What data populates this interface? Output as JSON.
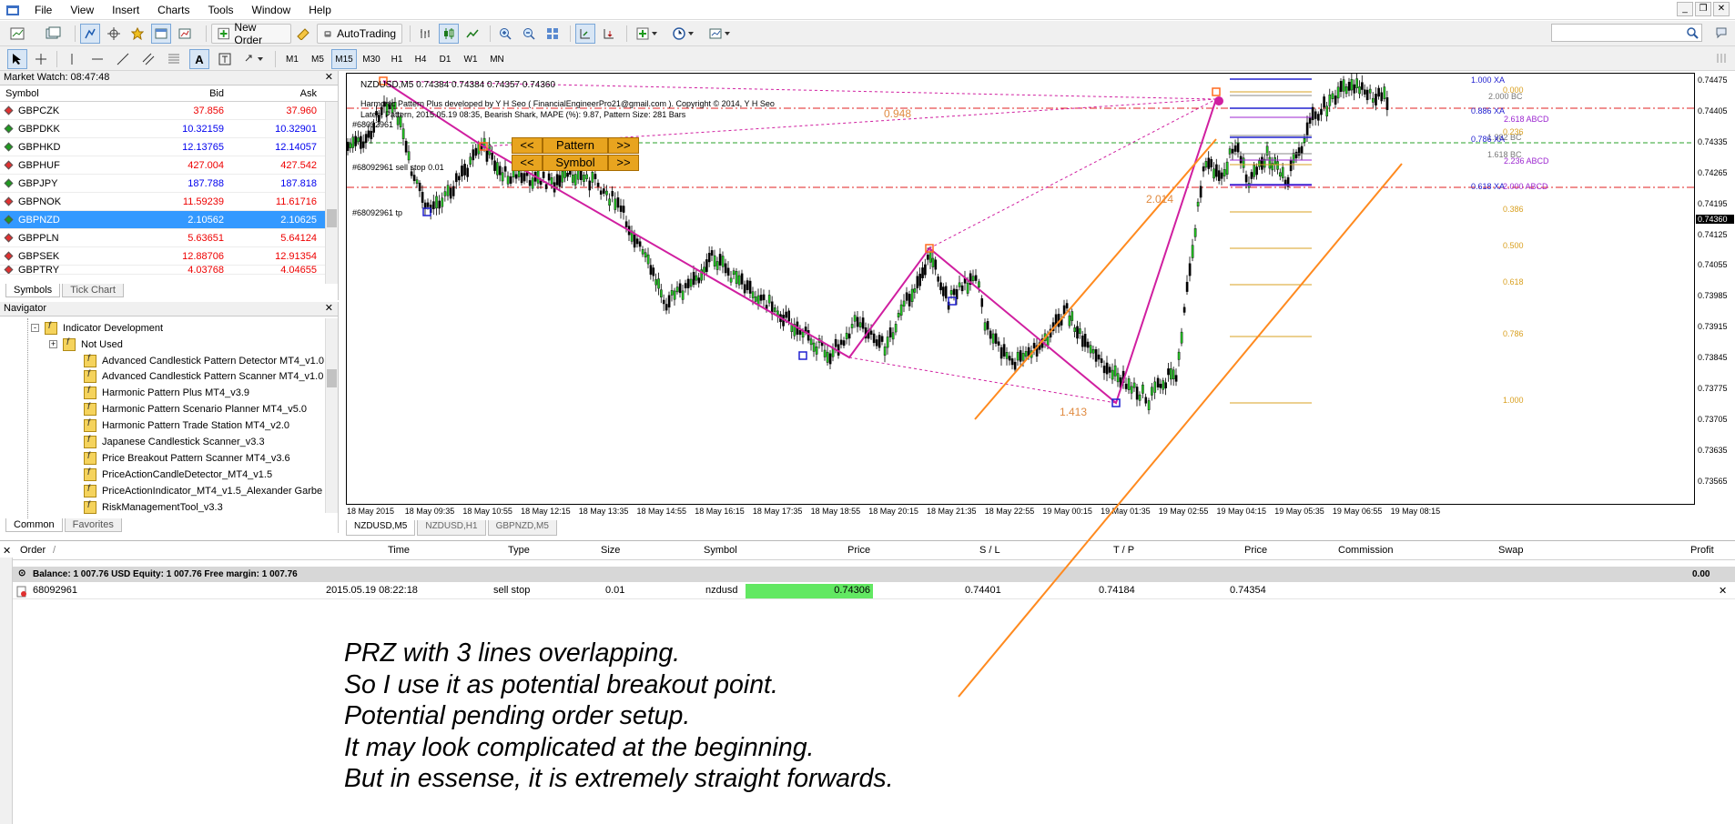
{
  "menu": [
    "File",
    "View",
    "Insert",
    "Charts",
    "Tools",
    "Window",
    "Help"
  ],
  "toolbar": {
    "new_order": "New Order",
    "autotrading": "AutoTrading",
    "timeframes": [
      "M1",
      "M5",
      "M15",
      "M30",
      "H1",
      "H4",
      "D1",
      "W1",
      "MN"
    ],
    "active_timeframe": "M15"
  },
  "market_watch": {
    "title": "Market Watch: 08:47:48",
    "columns": [
      "Symbol",
      "Bid",
      "Ask"
    ],
    "rows": [
      {
        "symbol": "GBPCZK",
        "bid": "37.856",
        "ask": "37.960",
        "dir": "down"
      },
      {
        "symbol": "GBPDKK",
        "bid": "10.32159",
        "ask": "10.32901",
        "dir": "up"
      },
      {
        "symbol": "GBPHKD",
        "bid": "12.13765",
        "ask": "12.14057",
        "dir": "up"
      },
      {
        "symbol": "GBPHUF",
        "bid": "427.004",
        "ask": "427.542",
        "dir": "down"
      },
      {
        "symbol": "GBPJPY",
        "bid": "187.788",
        "ask": "187.818",
        "dir": "up"
      },
      {
        "symbol": "GBPNOK",
        "bid": "11.59239",
        "ask": "11.61716",
        "dir": "down"
      },
      {
        "symbol": "GBPNZD",
        "bid": "2.10562",
        "ask": "2.10625",
        "dir": "up",
        "selected": true
      },
      {
        "symbol": "GBPPLN",
        "bid": "5.63651",
        "ask": "5.64124",
        "dir": "down"
      },
      {
        "symbol": "GBPSEK",
        "bid": "12.88706",
        "ask": "12.91354",
        "dir": "down"
      },
      {
        "symbol": "GBPTRY",
        "bid": "4.03768",
        "ask": "4.04655",
        "dir": "down"
      }
    ],
    "tabs": [
      "Symbols",
      "Tick Chart"
    ]
  },
  "navigator": {
    "title": "Navigator",
    "folder": "Indicator Development",
    "subfolder": "Not Used",
    "items": [
      "Advanced Candlestick Pattern Detector MT4_v1.0",
      "Advanced Candlestick Pattern Scanner MT4_v1.0",
      "Harmonic Pattern Plus MT4_v3.9",
      "Harmonic Pattern Scenario Planner MT4_v5.0",
      "Harmonic Pattern Trade Station MT4_v2.0",
      "Japanese Candlestick Scanner_v3.3",
      "Price Breakout Pattern Scanner MT4_v3.6",
      "PriceActionCandleDetector_MT4_v1.5",
      "PriceActionIndicator_MT4_v1.5_Alexander Garbe",
      "RiskManagementTool_v3.3"
    ],
    "tabs": [
      "Common",
      "Favorites"
    ]
  },
  "chart": {
    "header": "NZDUSD,M5  0.74384 0.74384 0.74357 0.74360",
    "info1": "Harmonic Pattern Plus developed by Y H Seo ( FinancialEngineerPro21@gmail.com ). Copyright © 2014, Y H Seo",
    "info2": "Latest Pattern, 2015.05.19 08:35, Bearish Shark, MAPE (%): 9.87, Pattern Size: 281 Bars",
    "order_label1": "#68092961",
    "order_label2": "#68092961 sell stop 0.01",
    "order_label3": "#68092961 tp",
    "btn_pattern": "Pattern",
    "btn_symbol": "Symbol",
    "btn_prev": "<<",
    "btn_next": ">>",
    "ratio_labels": [
      "0.948",
      "2.014",
      "1.413"
    ],
    "levels": [
      "1.000 XA",
      "2.000 BC",
      "0.886 XA",
      "2.618 ABCD",
      "1.382 BC",
      "0.786 XA",
      "1.618 BC",
      "2.236 ABCD",
      "0.618 XA",
      "2.000 ABCD"
    ],
    "fib_labels": [
      "0.000",
      "0.236",
      "0.386",
      "0.500",
      "0.618",
      "0.786",
      "1.000"
    ],
    "price_axis": [
      "0.74475",
      "0.74405",
      "0.74335",
      "0.74265",
      "0.74195",
      "0.74125",
      "0.74055",
      "0.73985",
      "0.73915",
      "0.73845",
      "0.73775",
      "0.73705",
      "0.73635",
      "0.73565"
    ],
    "current_price": "0.74360",
    "time_axis": [
      "18 May 2015",
      "18 May 09:35",
      "18 May 10:55",
      "18 May 12:15",
      "18 May 13:35",
      "18 May 14:55",
      "18 May 16:15",
      "18 May 17:35",
      "18 May 18:55",
      "18 May 20:15",
      "18 May 21:35",
      "18 May 22:55",
      "19 May 00:15",
      "19 May 01:35",
      "19 May 02:55",
      "19 May 04:15",
      "19 May 05:35",
      "19 May 06:55",
      "19 May 08:15"
    ],
    "tabs": [
      "NZDUSD,M5",
      "NZDUSD,H1",
      "GBPNZD,M5"
    ]
  },
  "terminal": {
    "columns": [
      "Order",
      "Time",
      "Type",
      "Size",
      "Symbol",
      "Price",
      "S / L",
      "T / P",
      "Price",
      "Commission",
      "Swap",
      "Profit"
    ],
    "balance": "Balance: 1 007.76 USD  Equity: 1 007.76  Free margin: 1 007.76",
    "balance_profit": "0.00",
    "order": {
      "id": "68092961",
      "time": "2015.05.19 08:22:18",
      "type": "sell stop",
      "size": "0.01",
      "symbol": "nzdusd",
      "price": "0.74306",
      "sl": "0.74401",
      "tp": "0.74184",
      "cur_price": "0.74354"
    }
  },
  "annotation": [
    "PRZ with 3 lines overlapping.",
    "So I use it as potential breakout point.",
    "Potential pending order setup.",
    "It may look complicated at the beginning.",
    "But in essense, it is extremely straight forwards."
  ],
  "colors": {
    "harmonic": "#d01fa0",
    "orange": "#ff8a1f",
    "stop": "#e02020",
    "entry": "#2aa02a",
    "fib": "#d9a020",
    "blue": "#2020d0",
    "purple": "#9c27d0"
  }
}
